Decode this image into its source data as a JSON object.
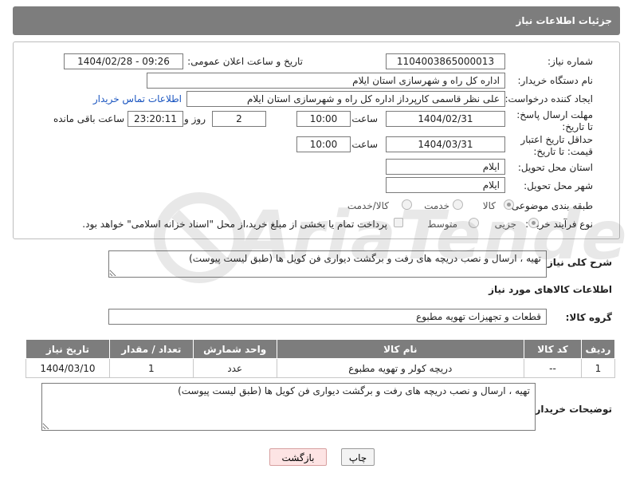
{
  "header": {
    "title": "جزئیات اطلاعات نیاز"
  },
  "form": {
    "need_number_label": "شماره نیاز:",
    "need_number": "1104003865000013",
    "announce_label": "تاریخ و ساعت اعلان عمومی:",
    "announce_value": "1404/02/28 - 09:26",
    "buyer_org_label": "نام دستگاه خریدار:",
    "buyer_org": "اداره کل راه و شهرسازی استان ایلام",
    "creator_label": "ایجاد کننده درخواست:",
    "creator": "علی نظر قاسمی کارپرداز اداره کل راه و شهرسازی استان ایلام",
    "contact_link": "اطلاعات تماس خریدار",
    "deadline_label": "مهلت ارسال پاسخ: تا تاریخ:",
    "deadline_date": "1404/02/31",
    "time_label": "ساعت",
    "deadline_time": "10:00",
    "days_value": "2",
    "days_label": "روز و",
    "remaining_time": "23:20:11",
    "remaining_label": "ساعت باقی مانده",
    "min_validity_label": "حداقل تاریخ اعتبار قیمت: تا تاریخ:",
    "validity_date": "1404/03/31",
    "validity_time": "10:00",
    "province_label": "استان محل تحویل:",
    "province": "ایلام",
    "city_label": "شهر محل تحویل:",
    "city": "ایلام",
    "category_label": "طبقه بندی موضوعی:",
    "category_options": [
      "کالا",
      "خدمت",
      "کالا/خدمت"
    ],
    "process_label": "نوع فرآیند خرید :",
    "process_options": [
      "جزیی",
      "متوسط"
    ],
    "payment_note": "پرداخت تمام یا بخشی از مبلغ خرید،از محل \"اسناد خزانه اسلامی\" خواهد بود."
  },
  "summary": {
    "label": "شرح کلی نیاز:",
    "text": "تهیه ، ارسال و نصب دریچه های رفت و برگشت دیواری فن کویل ها (طبق لیست پیوست)"
  },
  "goods": {
    "section_title": "اطلاعات کالاهای مورد نیاز",
    "group_label": "گروه کالا:",
    "group_value": "قطعات و تجهیزات تهویه مطبوع",
    "columns": [
      "ردیف",
      "کد کالا",
      "نام کالا",
      "واحد شمارش",
      "تعداد / مقدار",
      "تاریخ نیاز"
    ],
    "rows": [
      [
        "1",
        "--",
        "دریچه کولر و تهویه مطبوع",
        "عدد",
        "1",
        "1404/03/10"
      ]
    ]
  },
  "buyer_notes": {
    "label": "توضیحات خریدار:",
    "text": "تهیه ، ارسال و نصب دریچه های رفت و برگشت دیواری فن کویل ها (طبق لیست پیوست)"
  },
  "buttons": {
    "print": "چاپ",
    "back": "بازگشت"
  },
  "watermark": {
    "text": "AriaTender.net"
  },
  "colors": {
    "header_bg": "#7d7d7d",
    "link": "#1a55c0",
    "back_button_bg": "#fde4e4"
  }
}
